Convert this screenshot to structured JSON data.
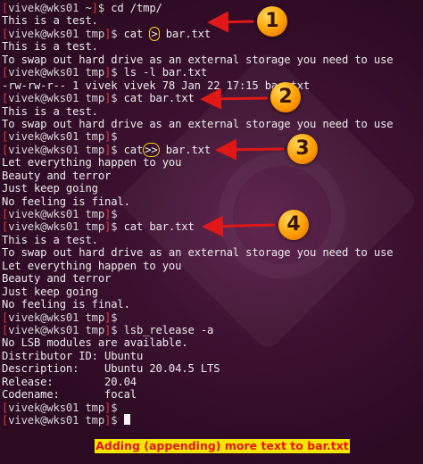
{
  "prompt": {
    "user": "vivek",
    "host": "wks01"
  },
  "lines": [
    {
      "type": "prompt",
      "dir": "~",
      "cmd": "cd /tmp/"
    },
    {
      "type": "output",
      "text": "This is a test."
    },
    {
      "type": "prompt",
      "dir": "tmp",
      "cmd": "cat > bar.txt",
      "pre": "cat ",
      "mark": ">",
      "post": " bar.txt"
    },
    {
      "type": "output",
      "text": "This is a test."
    },
    {
      "type": "output",
      "text": "To swap out hard drive as an external storage you need to use"
    },
    {
      "type": "prompt",
      "dir": "tmp",
      "cmd": "ls -l bar.txt"
    },
    {
      "type": "output",
      "text": "-rw-rw-r-- 1 vivek vivek 78 Jan 22 17:15 bar.txt"
    },
    {
      "type": "prompt",
      "dir": "tmp",
      "cmd": "cat bar.txt"
    },
    {
      "type": "output",
      "text": "This is a test."
    },
    {
      "type": "output",
      "text": "To swap out hard drive as an external storage you need to use"
    },
    {
      "type": "prompt",
      "dir": "tmp",
      "cmd": ""
    },
    {
      "type": "prompt",
      "dir": "tmp",
      "cmd": "cat >> bar.txt",
      "pre": "cat",
      "mark": ">>",
      "post": " bar.txt"
    },
    {
      "type": "output",
      "text": "Let everything happen to you"
    },
    {
      "type": "output",
      "text": "Beauty and terror"
    },
    {
      "type": "output",
      "text": "Just keep going"
    },
    {
      "type": "output",
      "text": "No feeling is final."
    },
    {
      "type": "prompt",
      "dir": "tmp",
      "cmd": ""
    },
    {
      "type": "prompt",
      "dir": "tmp",
      "cmd": "cat bar.txt"
    },
    {
      "type": "output",
      "text": "This is a test."
    },
    {
      "type": "output",
      "text": "To swap out hard drive as an external storage you need to use"
    },
    {
      "type": "output",
      "text": "Let everything happen to you"
    },
    {
      "type": "output",
      "text": "Beauty and terror"
    },
    {
      "type": "output",
      "text": "Just keep going"
    },
    {
      "type": "output",
      "text": "No feeling is final."
    },
    {
      "type": "prompt",
      "dir": "tmp",
      "cmd": ""
    },
    {
      "type": "prompt",
      "dir": "tmp",
      "cmd": "lsb_release -a"
    },
    {
      "type": "output",
      "text": "No LSB modules are available."
    },
    {
      "type": "output",
      "text": "Distributor ID:\tUbuntu"
    },
    {
      "type": "output",
      "text": "Description:\tUbuntu 20.04.5 LTS"
    },
    {
      "type": "output",
      "text": "Release:\t20.04"
    },
    {
      "type": "output",
      "text": "Codename:\tfocal"
    },
    {
      "type": "prompt",
      "dir": "tmp",
      "cmd": ""
    },
    {
      "type": "prompt",
      "dir": "tmp",
      "cmd": "",
      "cursor": true
    }
  ],
  "annotations": {
    "badges": [
      "1",
      "2",
      "3",
      "4"
    ],
    "caption": "Adding (appending) more text to bar.txt",
    "colors": {
      "arrow": "#e01818",
      "badge": "#ffa000",
      "circle": "#f5d800",
      "caption_bg": "#f5e600",
      "caption_text": "#e81414"
    }
  },
  "colors": {
    "background": "#2c0a22",
    "text": "#ececec",
    "bracket_red": "#e23a3a"
  }
}
